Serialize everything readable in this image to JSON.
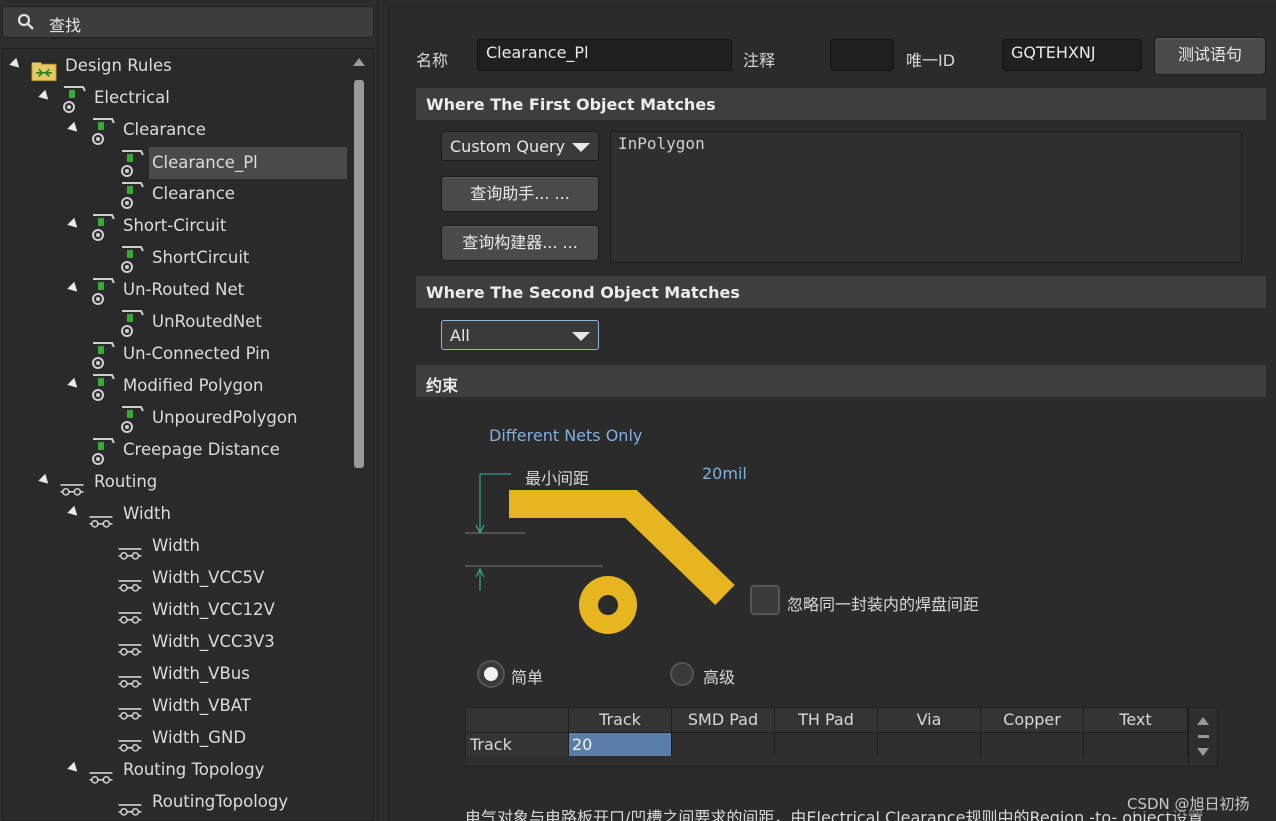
{
  "search": {
    "label": "查找"
  },
  "tree": {
    "items": [
      {
        "label": "Design Rules"
      },
      {
        "label": "Electrical"
      },
      {
        "label": "Clearance"
      },
      {
        "label": "Clearance_Pl"
      },
      {
        "label": "Clearance"
      },
      {
        "label": "Short-Circuit"
      },
      {
        "label": "ShortCircuit"
      },
      {
        "label": "Un-Routed Net"
      },
      {
        "label": "UnRoutedNet"
      },
      {
        "label": "Un-Connected Pin"
      },
      {
        "label": "Modified Polygon"
      },
      {
        "label": "UnpouredPolygon"
      },
      {
        "label": "Creepage Distance"
      },
      {
        "label": "Routing"
      },
      {
        "label": "Width"
      },
      {
        "label": "Width"
      },
      {
        "label": "Width_VCC5V"
      },
      {
        "label": "Width_VCC12V"
      },
      {
        "label": "Width_VCC3V3"
      },
      {
        "label": "Width_VBus"
      },
      {
        "label": "Width_VBAT"
      },
      {
        "label": "Width_GND"
      },
      {
        "label": "Routing Topology"
      },
      {
        "label": "RoutingTopology"
      }
    ]
  },
  "header": {
    "name_label": "名称",
    "name_value": "Clearance_Pl",
    "comment_label": "注释",
    "comment_value": "",
    "uid_label": "唯一ID",
    "uid_value": "GQTEHXNJ",
    "test_button": "测试语句"
  },
  "first_match": {
    "title": "Where The First Object Matches",
    "dropdown": "Custom Query",
    "helper_button": "查询助手... ...",
    "builder_button": "查询构建器... ...",
    "query": "InPolygon"
  },
  "second_match": {
    "title": "Where The Second Object Matches",
    "dropdown": "All"
  },
  "constraint": {
    "title": "约束",
    "net_mode": "Different Nets Only",
    "min_clearance_label": "最小间距",
    "min_clearance_value": "20mil",
    "ignore_pads_label": "忽略同一封装内的焊盘间距",
    "radio_simple": "简单",
    "radio_advanced": "高级",
    "columns": [
      "Track",
      "SMD Pad",
      "TH Pad",
      "Via",
      "Copper",
      "Text"
    ],
    "row_label": "Track",
    "row_value": "20",
    "footer_text": "电气对象与电路板开口/凹槽之间要求的间距，由Electrical Clearance规则中的Region -to- object设置",
    "watermark": "CSDN @旭日初扬"
  },
  "colors": {
    "accent": "#e6b520",
    "highlight": "#5a7ea8",
    "link": "#7fb0e0"
  }
}
